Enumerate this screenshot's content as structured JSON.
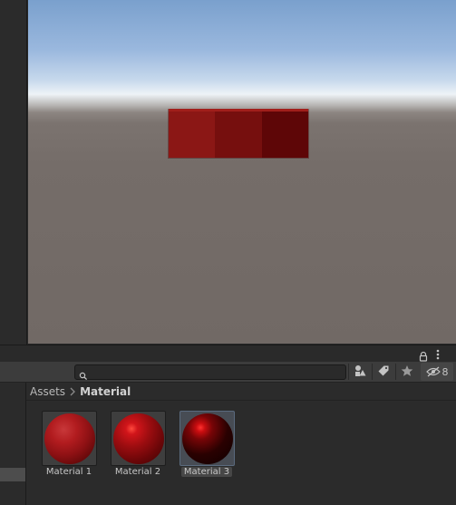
{
  "project": {
    "search": {
      "value": "",
      "placeholder": ""
    },
    "hidden_count": "8",
    "breadcrumb": {
      "root": "Assets",
      "current": "Material"
    },
    "assets": [
      {
        "label": "Material 1",
        "icon": "sphere-material-thumbnail"
      },
      {
        "label": "Material 2",
        "icon": "sphere-material-thumbnail"
      },
      {
        "label": "Material 3",
        "icon": "sphere-material-thumbnail",
        "selected": true
      }
    ]
  },
  "colors": {
    "editor_background": "#282828",
    "toolbar_background": "#3c3c3c",
    "cube_red": "#8b1715",
    "selection": "#474c54"
  }
}
